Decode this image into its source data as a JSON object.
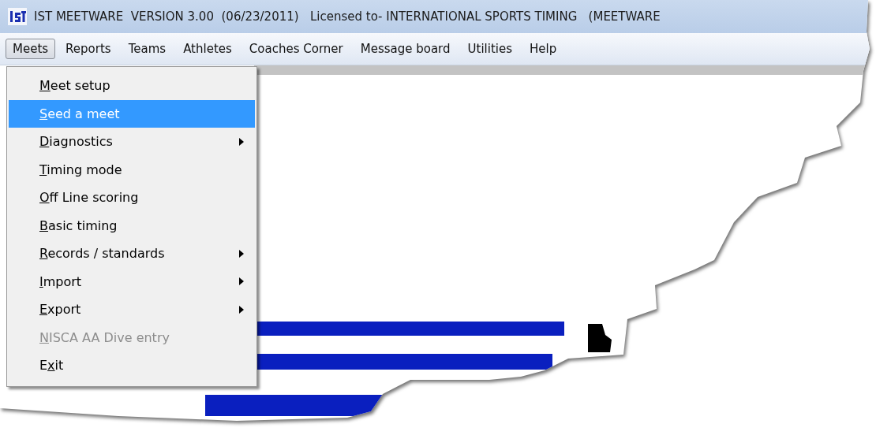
{
  "window": {
    "title": "IST MEETWARE  VERSION 3.00  (06/23/2011)   Licensed to- INTERNATIONAL SPORTS TIMING   (MEETWARE"
  },
  "menu_bar": [
    {
      "label": "Meets",
      "selected": true
    },
    {
      "label": "Reports",
      "selected": false
    },
    {
      "label": "Teams",
      "selected": false
    },
    {
      "label": "Athletes",
      "selected": false
    },
    {
      "label": "Coaches Corner",
      "selected": false
    },
    {
      "label": "Message board",
      "selected": false
    },
    {
      "label": "Utilities",
      "selected": false
    },
    {
      "label": "Help",
      "selected": false
    }
  ],
  "menu": [
    {
      "key": "M",
      "after": "eet setup",
      "selected": false,
      "disabled": false,
      "submenu": false
    },
    {
      "key": "S",
      "after": "eed a meet",
      "selected": true,
      "disabled": false,
      "submenu": false
    },
    {
      "key": "D",
      "after": "iagnostics",
      "selected": false,
      "disabled": false,
      "submenu": true
    },
    {
      "key": "T",
      "after": "iming mode",
      "selected": false,
      "disabled": false,
      "submenu": false
    },
    {
      "key": "O",
      "after": "ff Line scoring",
      "selected": false,
      "disabled": false,
      "submenu": false
    },
    {
      "key": "B",
      "after": "asic timing",
      "selected": false,
      "disabled": false,
      "submenu": false
    },
    {
      "key": "R",
      "after": "ecords / standards",
      "selected": false,
      "disabled": false,
      "submenu": true
    },
    {
      "key": "I",
      "after": "mport",
      "selected": false,
      "disabled": false,
      "submenu": true
    },
    {
      "key": "E",
      "after": "xport",
      "selected": false,
      "disabled": false,
      "submenu": true
    },
    {
      "key": "N",
      "after": "ISCA AA Dive entry",
      "selected": false,
      "disabled": true,
      "submenu": false
    },
    {
      "before": "E",
      "key": "x",
      "after": "it",
      "selected": false,
      "disabled": false,
      "submenu": false
    }
  ]
}
